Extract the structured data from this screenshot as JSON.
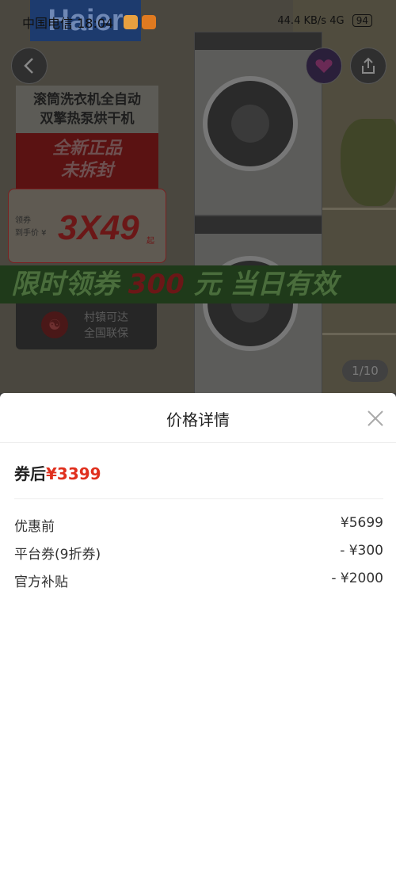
{
  "status_bar": {
    "carrier": "中国电信",
    "time": "18:04",
    "signal_text": "44.4 KB/s",
    "network": "4G",
    "battery": "94"
  },
  "product_image": {
    "brand_logo": "Haier",
    "promo_line1": "滚筒洗衣机全自动",
    "promo_line2": "双擎热泵烘干机",
    "promo_red_1": "全新正品",
    "promo_red_2": "未拆封",
    "price_label_1": "领券",
    "price_label_2": "到手价 ¥",
    "price_big": "3X49",
    "price_suffix": "起",
    "banner_prefix": "限时领券",
    "banner_number": "300",
    "banner_suffix": "元 当日有效",
    "assurance_line1": "村镇可达",
    "assurance_line2": "全国联保",
    "image_counter": "1/10"
  },
  "sheet": {
    "title": "价格详情",
    "total_label": "券后",
    "total_price": "¥3399",
    "rows": [
      {
        "label": "优惠前",
        "value": "¥5699"
      },
      {
        "label": "平台券(9折券)",
        "value": "- ¥300"
      },
      {
        "label": "官方补贴",
        "value": "- ¥2000"
      }
    ]
  },
  "icons": {
    "back": "chevron-left-icon",
    "share": "share-icon",
    "close": "close-icon"
  }
}
